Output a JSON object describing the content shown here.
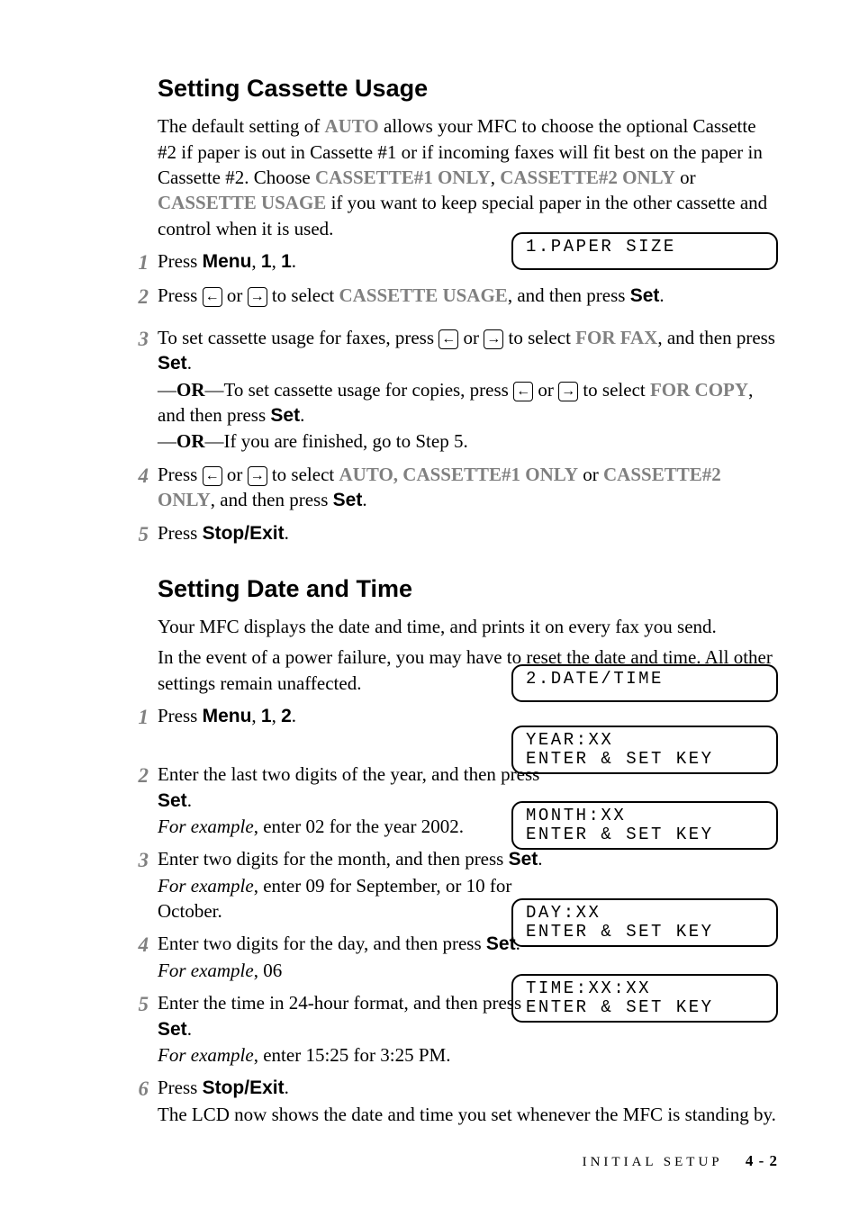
{
  "section1": {
    "heading": "Setting Cassette Usage",
    "intro_p1a": "The default setting of ",
    "intro_auto": "AUTO",
    "intro_p1b": " allows your MFC to choose the optional Cassette #2 if paper is out in Cassette #1 or if incoming faxes will fit best on the paper in Cassette #2. Choose ",
    "intro_c1": "CASSETTE#1 ONLY",
    "intro_comma1": ", ",
    "intro_c2": "CASSETTE#2 ONLY",
    "intro_or": " or ",
    "intro_cu": "CASSETTE USAGE",
    "intro_p1c": " if you want to keep special paper in the other cassette and control when it is used.",
    "steps": {
      "s1_a": "Press ",
      "s1_menu": "Menu",
      "s1_b": ", ",
      "s1_n1": "1",
      "s1_c": ", ",
      "s1_n2": "1",
      "s1_d": ".",
      "s2_a": "Press  ",
      "arrow_l": "←",
      "arrow_r": "→",
      "s2_or": "  or  ",
      "s2_b": "  to select ",
      "s2_cu": "CASSETTE USAGE",
      "s2_c": ", and then press ",
      "s2_set": "Set",
      "s2_d": ".",
      "s3_a": "To set cassette usage for faxes, press  ",
      "s3_b": "  to select ",
      "s3_ff": "FOR FAX",
      "s3_c": ", and then press ",
      "s3_d": ".",
      "s3_or1a": "—",
      "s3_or1b": "OR",
      "s3_or1c": "—To set cassette usage for copies, press  ",
      "s3_fc": "FOR COPY",
      "s3_or1d": ", and then press ",
      "s3_or1e": ".",
      "s3_or2a": "—",
      "s3_or2b": "OR",
      "s3_or2c": "—If you are finished, go to Step 5.",
      "s4_a": "Press  ",
      "s4_b": "  to select ",
      "s4_auto": "AUTO, CASSETTE#1 ONLY",
      "s4_or": " or ",
      "s4_c2": "CASSETTE#2 ONLY",
      "s4_c": ", and then press ",
      "s4_d": ".",
      "s5_a": "Press ",
      "s5_se": "Stop/Exit",
      "s5_b": "."
    },
    "lcd1": "1.PAPER SIZE"
  },
  "section2": {
    "heading": "Setting Date and Time",
    "intro_p1": "Your MFC displays the date and time, and prints it on every fax you send.",
    "intro_p2": "In the event of a power failure, you may have to reset the date and time. All other settings remain unaffected.",
    "steps": {
      "s1_a": "Press ",
      "s1_menu": "Menu",
      "s1_b": ", ",
      "s1_n1": "1",
      "s1_c": ", ",
      "s1_n2": "2",
      "s1_d": ".",
      "s2_a": "Enter the last two digits of the year, and then press ",
      "s2_set": "Set",
      "s2_b": ".",
      "s2_ex_a": "For example",
      "s2_ex_b": ", enter 02 for the year 2002.",
      "s3_a": "Enter two digits for the month, and then press ",
      "s3_b": ".",
      "s3_ex_a": "For example",
      "s3_ex_b": ", enter 09 for September, or 10 for October.",
      "s4_a": "Enter two digits for the day, and then press ",
      "s4_b": ".",
      "s4_ex_a": "For example",
      "s4_ex_b": ", 06",
      "s5_a": "Enter the time in 24-hour format, and then press ",
      "s5_b": ".",
      "s5_ex_a": "For example",
      "s5_ex_b": ", enter 15:25 for 3:25 PM.",
      "s6_a": "Press ",
      "s6_se": "Stop/Exit",
      "s6_b": ".",
      "s6_c": "The LCD now shows the date and time you set whenever the MFC is standing by."
    },
    "lcd1": "2.DATE/TIME",
    "lcd2": "YEAR:XX\nENTER & SET KEY",
    "lcd3": "MONTH:XX\nENTER & SET KEY",
    "lcd4": "DAY:XX\nENTER & SET KEY",
    "lcd5": "TIME:XX:XX\nENTER & SET KEY"
  },
  "footer": {
    "label": "INITIAL SETUP",
    "page": "4 - 2"
  }
}
